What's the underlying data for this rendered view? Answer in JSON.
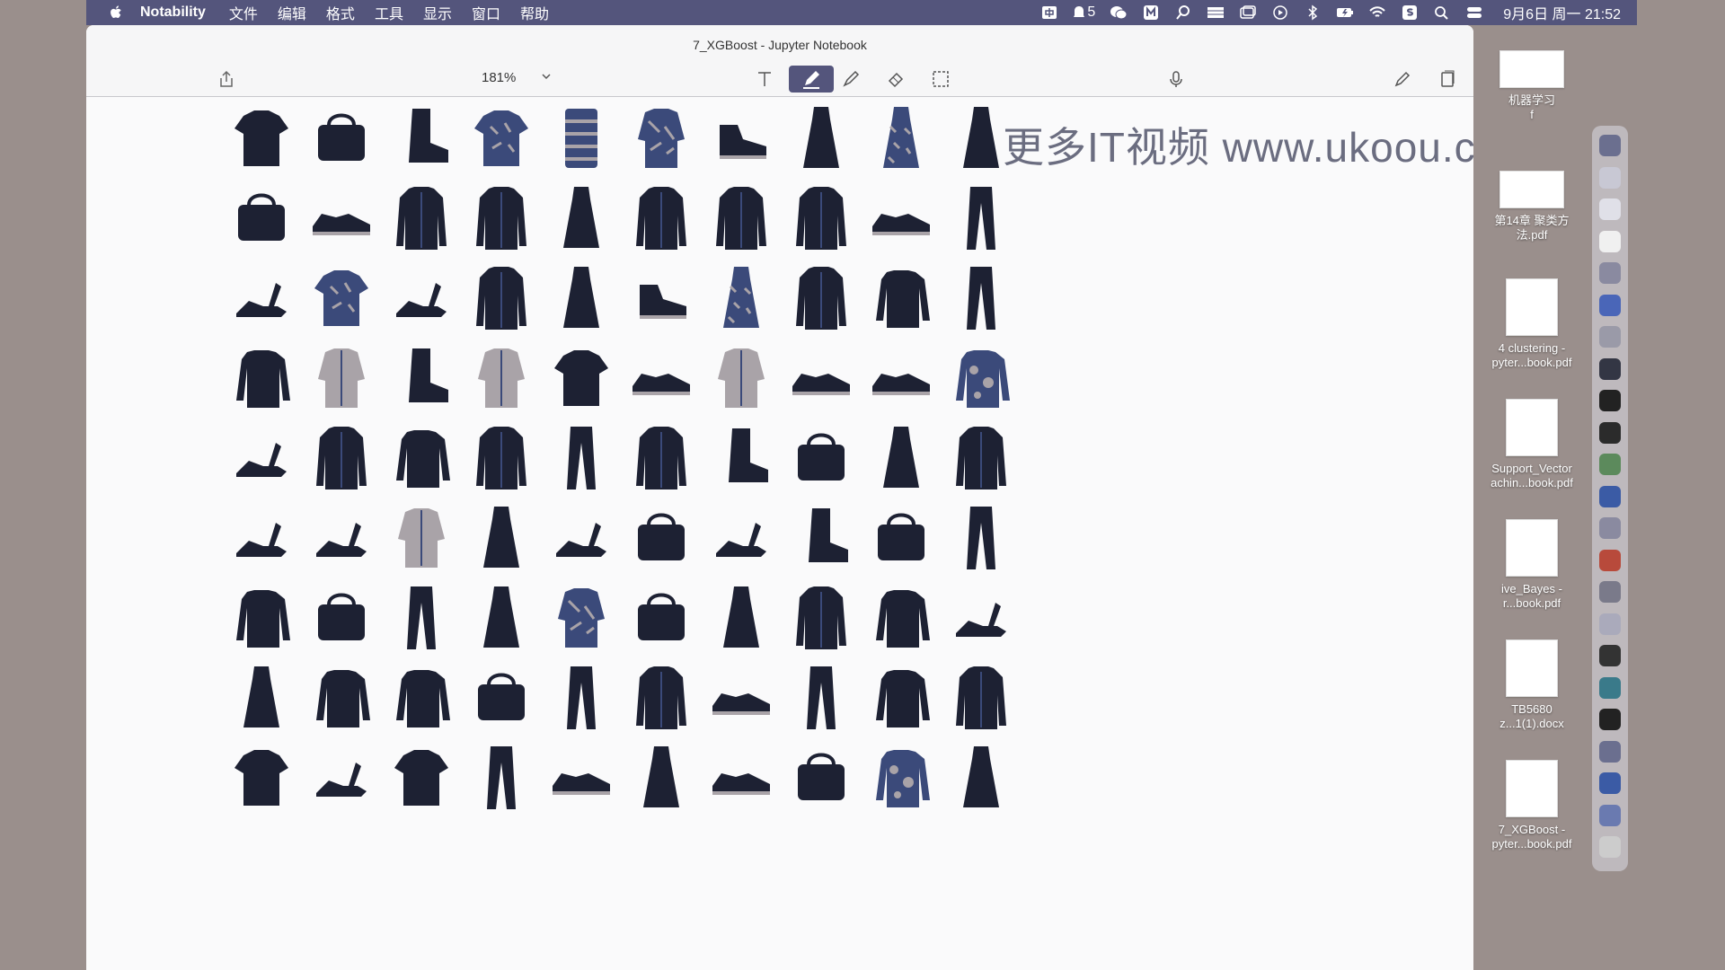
{
  "menubar": {
    "app_name": "Notability",
    "items": [
      "文件",
      "编辑",
      "格式",
      "工具",
      "显示",
      "窗口",
      "帮助"
    ],
    "battery_badge": "5",
    "clock": "9月6日 周一  21:52"
  },
  "window": {
    "title": "7_XGBoost - Jupyter Notebook",
    "zoom": "181%"
  },
  "watermark": "更多IT视频  www.ukoou.com",
  "colors": {
    "accent": "#54557c",
    "item_dark": "#1d2133",
    "item_mid": "#3b4a7a",
    "item_light": "#a9a3a8"
  },
  "grid": {
    "rows": [
      [
        "tshirt",
        "bag",
        "boot",
        "tshirt-pattern",
        "sweater",
        "shirt-pattern",
        "sneaker-high",
        "dress",
        "dress-pattern",
        "dress"
      ],
      [
        "bag",
        "sneaker",
        "coat",
        "coat",
        "dress",
        "coat",
        "coat",
        "coat",
        "sneaker",
        "trouser"
      ],
      [
        "sandal",
        "tshirt-pattern",
        "sandal",
        "coat",
        "dress",
        "sneaker-high",
        "dress-pattern",
        "coat",
        "pullover",
        "trouser"
      ],
      [
        "pullover",
        "shirt",
        "boot",
        "shirt",
        "tshirt",
        "sneaker",
        "shirt",
        "sneaker",
        "sneaker",
        "pullover-pattern"
      ],
      [
        "sandal",
        "coat",
        "pullover",
        "coat",
        "trouser",
        "coat",
        "boot",
        "bag",
        "dress",
        "coat"
      ],
      [
        "sandal",
        "sandal",
        "shirt",
        "dress",
        "sandal",
        "bag",
        "sandal",
        "boot",
        "bag",
        "trouser"
      ],
      [
        "pullover",
        "bag",
        "trouser",
        "dress",
        "shirt-pattern",
        "bag",
        "dress",
        "coat",
        "pullover",
        "sandal"
      ],
      [
        "dress",
        "pullover",
        "pullover",
        "bag",
        "trouser",
        "coat",
        "sneaker",
        "trouser",
        "pullover",
        "coat"
      ],
      [
        "tshirt",
        "sandal",
        "tshirt",
        "trouser",
        "sneaker",
        "dress",
        "sneaker",
        "bag",
        "pullover-pattern",
        "dress"
      ]
    ]
  },
  "files": [
    {
      "label": "机器学习\nf"
    },
    {
      "label": "第14章 聚类方\n法.pdf"
    },
    {
      "label": "4 clustering -\npyter...book.pdf"
    },
    {
      "label": "Support_Vector\nachin...book.pdf"
    },
    {
      "label": "ive_Bayes -\nr...book.pdf"
    },
    {
      "label": "TB5680\nz...1(1).docx"
    },
    {
      "label": "7_XGBoost -\npyter...book.pdf"
    }
  ],
  "dock": [
    "finder-icon",
    "chrome-icon",
    "calendar-icon",
    "notes-icon",
    "sheets-icon",
    "vscode-icon",
    "preview-icon",
    "pen-icon",
    "terminal-icon",
    "qq-icon",
    "wechat-icon",
    "word-icon",
    "screenshot-icon",
    "powerpoint-icon",
    "settings-icon",
    "scale-icon",
    "github-icon",
    "gitkraken-icon",
    "typora-icon",
    "slack-icon",
    "notability-icon",
    "feather-icon",
    "trash-icon"
  ]
}
